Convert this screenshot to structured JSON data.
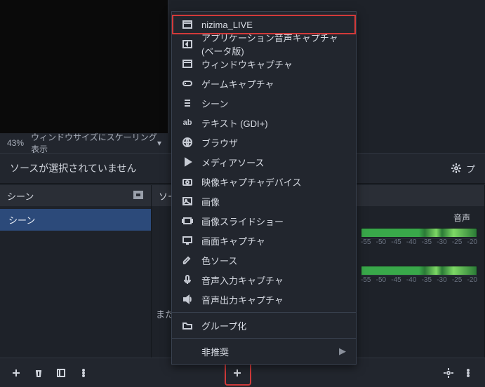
{
  "zoom": {
    "percent": "43%",
    "mode": "ウィンドウサイズにスケーリング表示"
  },
  "infobar": {
    "message": "ソースが選択されていません",
    "properties": "プ"
  },
  "panels": {
    "scenes": {
      "title": "シーン",
      "items": [
        "シーン"
      ]
    },
    "sources": {
      "title": "ソー",
      "hint": "また"
    },
    "mixer": {
      "track1": "音声",
      "scale": [
        "-55",
        "-50",
        "-45",
        "-40",
        "-35",
        "-30",
        "-25",
        "-20"
      ]
    }
  },
  "menu": {
    "items": [
      {
        "icon": "window",
        "label": "nizima_LIVE",
        "hl": true
      },
      {
        "icon": "appaudio",
        "label": "アプリケーション音声キャプチャ (ベータ版)"
      },
      {
        "icon": "window",
        "label": "ウィンドウキャプチャ"
      },
      {
        "icon": "gamepad",
        "label": "ゲームキャプチャ"
      },
      {
        "icon": "list",
        "label": "シーン"
      },
      {
        "icon": "text",
        "label": "テキスト (GDI+)"
      },
      {
        "icon": "globe",
        "label": "ブラウザ"
      },
      {
        "icon": "play",
        "label": "メディアソース"
      },
      {
        "icon": "camera",
        "label": "映像キャプチャデバイス"
      },
      {
        "icon": "image",
        "label": "画像"
      },
      {
        "icon": "slideshow",
        "label": "画像スライドショー"
      },
      {
        "icon": "monitor",
        "label": "画面キャプチャ"
      },
      {
        "icon": "brush",
        "label": "色ソース"
      },
      {
        "icon": "mic",
        "label": "音声入力キャプチャ"
      },
      {
        "icon": "speaker",
        "label": "音声出力キャプチャ"
      }
    ],
    "group": "グループ化",
    "deprecated": "非推奨"
  }
}
